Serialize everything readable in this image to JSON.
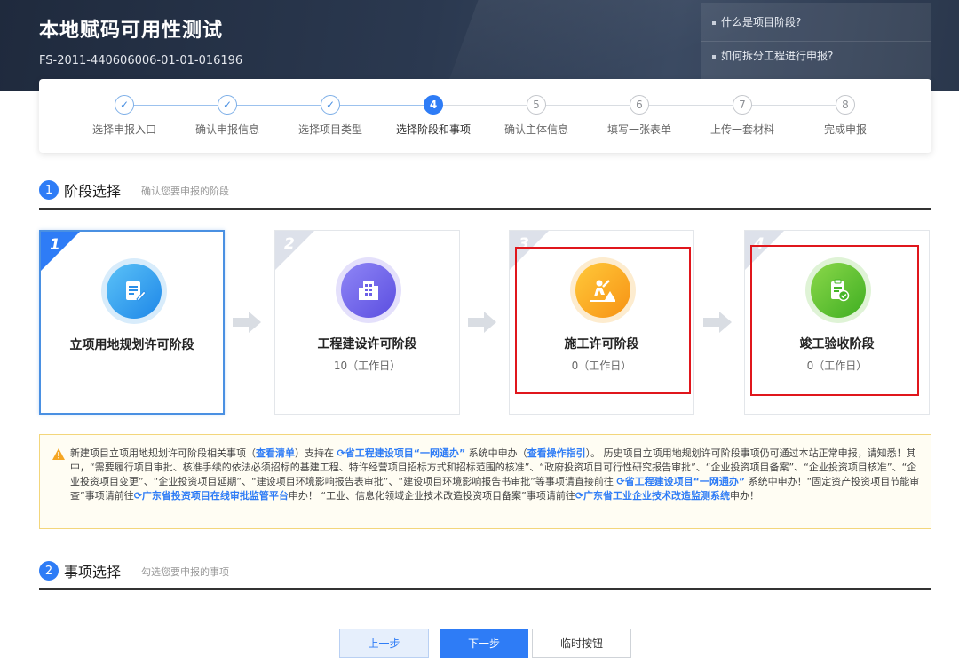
{
  "header": {
    "title": "本地赋码可用性测试",
    "code": "FS-2011-440606006-01-01-016196",
    "help_links": [
      "什么是项目阶段?",
      "如何拆分工程进行申报?"
    ]
  },
  "steps": [
    {
      "num": "✓",
      "label": "选择申报入口",
      "state": "done"
    },
    {
      "num": "✓",
      "label": "确认申报信息",
      "state": "done"
    },
    {
      "num": "✓",
      "label": "选择项目类型",
      "state": "done"
    },
    {
      "num": "4",
      "label": "选择阶段和事项",
      "state": "current"
    },
    {
      "num": "5",
      "label": "确认主体信息",
      "state": "todo"
    },
    {
      "num": "6",
      "label": "填写一张表单",
      "state": "todo"
    },
    {
      "num": "7",
      "label": "上传一套材料",
      "state": "todo"
    },
    {
      "num": "8",
      "label": "完成申报",
      "state": "todo"
    }
  ],
  "section1": {
    "num": "1",
    "title": "阶段选择",
    "subtitle": "确认您要申报的阶段"
  },
  "stages": [
    {
      "num": "1",
      "name": "立项用地规划许可阶段",
      "days": ""
    },
    {
      "num": "2",
      "name": "工程建设许可阶段",
      "days": "10（工作日）"
    },
    {
      "num": "3",
      "name": "施工许可阶段",
      "days": "0（工作日）"
    },
    {
      "num": "4",
      "name": "竣工验收阶段",
      "days": "0（工作日）"
    }
  ],
  "notice": {
    "p1": "新建项目立项用地规划许可阶段相关事项（",
    "l1": "查看清单",
    "p2": "）支持在 ",
    "l2": "⟳省工程建设项目“一网通办”",
    "p3": " 系统中申办（",
    "l3": "查看操作指引",
    "p4": "）。 历史项目立项用地规划许可阶段事项仍可通过本站正常申报，请知悉！其中，“需要履行项目审批、核准手续的依法必须招标的基建工程、特许经营项目招标方式和招标范围的核准”、“政府投资项目可行性研究报告审批”、“企业投资项目备案”、“企业投资项目核准”、“企业投资项目变更”、“企业投资项目延期”、“建设项目环境影响报告表审批”、“建设项目环境影响报告书审批”等事项请直接前往 ",
    "l4": "⟳省工程建设项目“一网通办”",
    "p5": " 系统中申办！“固定资产投资项目节能审查”事项请前往",
    "l5": "⟳广东省投资项目在线审批监管平台",
    "p6": "申办！ “工业、信息化领域企业技术改造投资项目备案”事项请前往",
    "l6": "⟳广东省工业企业技术改造监测系统",
    "p7": "申办！"
  },
  "section2": {
    "num": "2",
    "title": "事项选择",
    "subtitle": "勾选您要申报的事项"
  },
  "buttons": {
    "prev": "上一步",
    "next": "下一步",
    "temp": "临时按钮"
  },
  "colors": {
    "accent": "#2e7cf6",
    "highlight": "#e0161c",
    "selected_border": "#4a90e2"
  }
}
